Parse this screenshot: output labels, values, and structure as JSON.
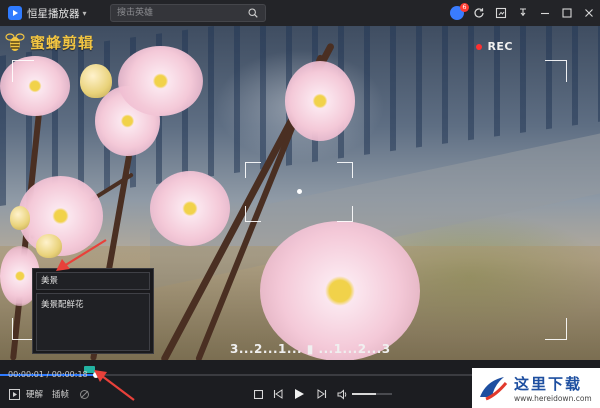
{
  "titlebar": {
    "app_title": "恒星播放器",
    "search_placeholder": "搜击英雄",
    "badge_count": "6"
  },
  "video": {
    "logo_text": "蜜蜂剪辑",
    "rec_label": "REC",
    "countdown": "3...2...1... ▮ ...1...2...3"
  },
  "subtitle_panel": {
    "line_1": "美景",
    "line_2": "美景配鲜花"
  },
  "controls": {
    "time": "00:00:01 / 00:00:18",
    "hardware_decode_label": "硬解",
    "frame_label": "插帧",
    "progress_fraction": 0.16
  },
  "watermark": {
    "title": "这里下载",
    "url": "www.hereidown.com"
  },
  "colors": {
    "accent_blue": "#2f7bff",
    "rec_red": "#ff3030",
    "logo_gold": "#f2c542",
    "clip_marker": "#22b3a2",
    "arrow_red": "#e8413a"
  }
}
